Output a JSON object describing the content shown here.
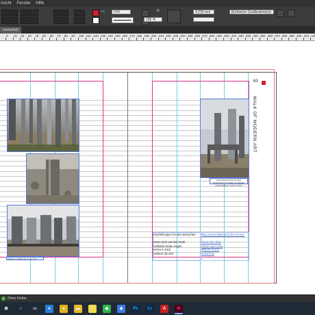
{
  "menu": {
    "items": [
      "nsicht",
      "Fenster",
      "Hilfe"
    ]
  },
  "toolbar": {
    "stroke_weight": "0 Pt",
    "opacity": "100 %",
    "measure": "4,233 mm",
    "object_style": "[Einfacher Grafikrahmen]+",
    "colors": {
      "fill": "#d0202e",
      "stroke": "#ffffff"
    }
  },
  "document_tab": {
    "label": "earbeitet)"
  },
  "ruler": {
    "labels": [
      "0",
      "10",
      "20",
      "30",
      "40",
      "50",
      "60",
      "70",
      "80",
      "90",
      "100",
      "110",
      "120",
      "130",
      "140",
      "150",
      "160",
      "170",
      "180",
      "190",
      "200",
      "210",
      "220",
      "230",
      "240",
      "250",
      "260",
      "270",
      "280",
      "290",
      "300",
      "310",
      "320",
      "330",
      "340",
      "350",
      "360",
      "370",
      "380",
      "390",
      "400",
      "410",
      "420"
    ]
  },
  "page": {
    "page_number": "63",
    "vertical_title": "WALK OF MODERN ART",
    "caption_left": "Schilder im Wald der Kunst Tirol",
    "caption_right": "SCHILDER IM WALD DER KUNSTSKULPTUREN IM FREIEN AUSGESTELLT VON KUNST ",
    "german_text": [
      "Empfehlungen für den Betrachter:",
      "",
      "Setze Dich auf den Stuhl",
      "Schließe Deine Augen",
      "Kehre in Dich",
      "Verliere die Zeit"
    ],
    "english_text": [
      "Recommendations for the viewer:",
      "",
      "Sit on the chair",
      "Close your eyes",
      "Return in you",
      "Lose time"
    ]
  },
  "status": {
    "errors": "Ohne Fehler"
  },
  "taskbar": {
    "apps": [
      "windows-icon",
      "search-icon",
      "task-view-icon",
      "edge-icon",
      "chrome-icon",
      "file-explorer-icon",
      "sticky-notes-icon",
      "whatsapp-icon",
      "messenger-icon",
      "photoshop-icon",
      "lightroom-icon",
      "acrobat-icon",
      "indesign-icon"
    ]
  }
}
